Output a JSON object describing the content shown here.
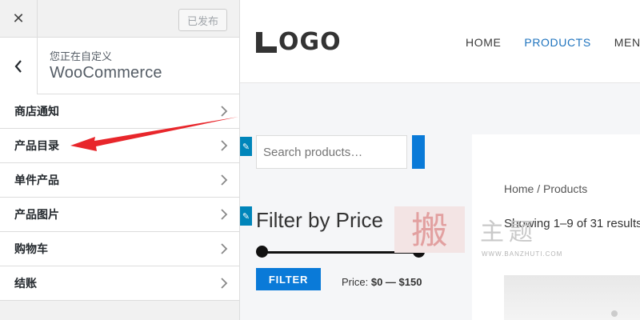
{
  "panel": {
    "close_icon": "close-icon",
    "publish_label": "已发布",
    "back_icon": "chevron-left-icon",
    "customizing_label": "您正在自定义",
    "section_title": "WooCommerce",
    "items": [
      {
        "label": "商店通知"
      },
      {
        "label": "产品目录"
      },
      {
        "label": "单件产品"
      },
      {
        "label": "产品图片"
      },
      {
        "label": "购物车"
      },
      {
        "label": "结账"
      }
    ]
  },
  "site": {
    "logo_text": "OGO",
    "nav": [
      "HOME",
      "PRODUCTS",
      "MEN"
    ],
    "nav_active": "PRODUCTS",
    "search_placeholder": "Search products…",
    "filter_title": "Filter by Price",
    "filter_button": "FILTER",
    "price_prefix": "Price:",
    "price_range": "$0 — $150",
    "breadcrumb": "Home / Products",
    "result_count": "Showing 1–9 of 31 results"
  },
  "watermark": {
    "text": "主题",
    "url": "WWW.BANZHUTI.COM"
  },
  "colors": {
    "accent": "#0a7ad8",
    "nav_active": "#1e73be",
    "arrow": "#e8262b"
  }
}
